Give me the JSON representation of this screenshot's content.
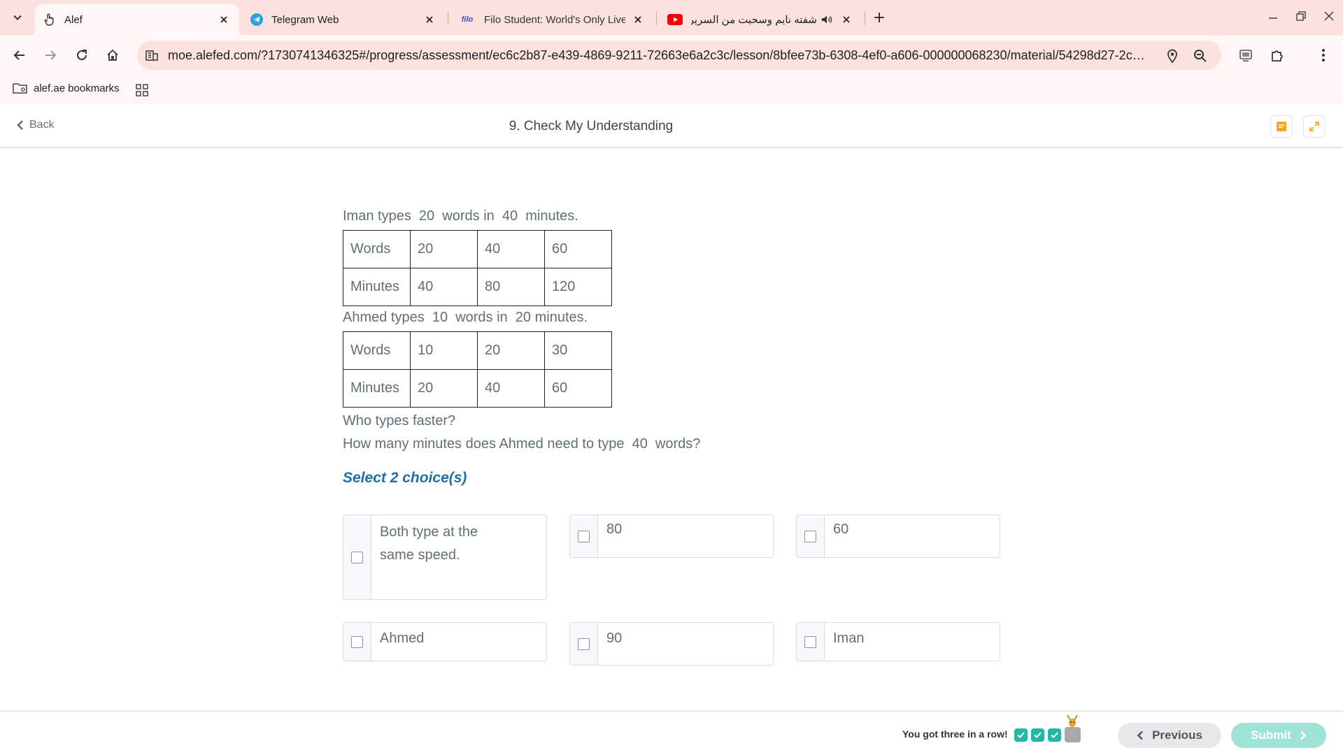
{
  "browser": {
    "tabs": [
      {
        "title": "Alef",
        "icon": "hand-pointer-icon",
        "active": true
      },
      {
        "title": "Telegram Web",
        "icon": "telegram-icon",
        "active": false
      },
      {
        "title": "Filo Student: World's Only Live I",
        "favicon_text": "filo",
        "icon": "filo-icon",
        "active": false
      },
      {
        "title": "شفته نايم وسحبت من السرير",
        "icon": "youtube-icon",
        "active": false,
        "audio": true
      }
    ],
    "url": "moe.alefed.com/?1730741346325#/progress/assessment/ec6c2b87-e439-4869-9211-72663e6a2c3c/lesson/8bfee73b-6308-4ef0-a606-000000068230/material/54298d27-2c91-...",
    "bookmarks": [
      {
        "label": "alef.ae bookmarks",
        "icon": "folder-icon"
      }
    ]
  },
  "header": {
    "back_label": "Back",
    "lesson_title": "9. Check My Understanding"
  },
  "question": {
    "intro1": "Iman types  20  words in  40  minutes.",
    "table1": [
      [
        "Words",
        "20",
        "40",
        "60"
      ],
      [
        "Minutes",
        "40",
        "80",
        "120"
      ]
    ],
    "intro2": "Ahmed types  10  words in  20 minutes.",
    "table2": [
      [
        "Words",
        "10",
        "20",
        "30"
      ],
      [
        "Minutes",
        "20",
        "40",
        "60"
      ]
    ],
    "q1": "Who types faster?",
    "q2": "How many minutes does Ahmed need to type  40  words?",
    "instruction": "Select 2 choice(s)",
    "choices": [
      "Both type at the same speed.",
      "80",
      "60",
      "Ahmed",
      "90",
      "Iman"
    ]
  },
  "footer": {
    "streak_text": "You got three in a row!",
    "streak": [
      true,
      true,
      true,
      false
    ],
    "previous_label": "Previous",
    "submit_label": "Submit"
  },
  "colors": {
    "accent": "#1f6fa5",
    "teal": "#26b5a4",
    "submit": "#9ee2d8",
    "chrome": "#fbe2df"
  }
}
